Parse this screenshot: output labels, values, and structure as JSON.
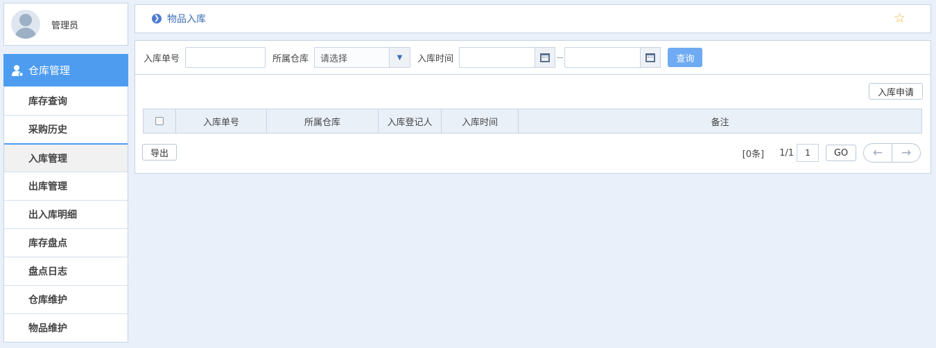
{
  "user": {
    "name": "管理员"
  },
  "sidebar": {
    "section_title": "仓库管理",
    "items": [
      {
        "label": "库存查询"
      },
      {
        "label": "采购历史"
      },
      {
        "label": "入库管理"
      },
      {
        "label": "出库管理"
      },
      {
        "label": "出入库明细"
      },
      {
        "label": "库存盘点"
      },
      {
        "label": "盘点日志"
      },
      {
        "label": "仓库维护"
      },
      {
        "label": "物品维护"
      }
    ],
    "active_index": 2
  },
  "breadcrumb": {
    "label": "物品入库"
  },
  "filters": {
    "order_no_label": "入库单号",
    "order_no_value": "",
    "warehouse_label": "所属仓库",
    "warehouse_value": "请选择",
    "time_label": "入库时间",
    "time_from": "",
    "time_separator": "--",
    "time_to": "",
    "query_label": "查询"
  },
  "toolbar": {
    "apply_label": "入库申请"
  },
  "table": {
    "columns": [
      "入库单号",
      "所属仓库",
      "入库登记人",
      "入库时间",
      "备注"
    ],
    "rows": []
  },
  "footer": {
    "export_label": "导出",
    "record_count": "[0条]",
    "page_info": "1/1",
    "page_input": "1",
    "go_label": "GO",
    "prev_icon": "arrow-left-icon",
    "next_icon": "arrow-right-icon"
  },
  "colors": {
    "accent": "#4e9cf0",
    "query_button": "#6fabf2",
    "background": "#e9f0f9",
    "breadcrumb_text": "#3d6fb8",
    "star": "#f0b840"
  }
}
